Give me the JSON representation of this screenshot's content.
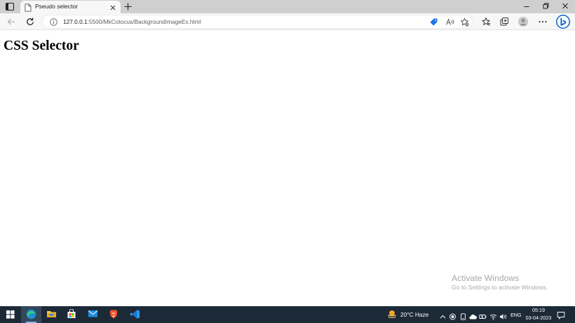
{
  "browser": {
    "tab": {
      "title": "Pseudo selector"
    },
    "address_bar": {
      "host": "127.0.0.1",
      "rest": ":5500/MkCotocus/BackgroundImageEx.html"
    }
  },
  "page": {
    "heading": "CSS Selector"
  },
  "watermark": {
    "title": "Activate Windows",
    "subtitle": "Go to Settings to activate Windows."
  },
  "taskbar": {
    "weather": "20°C  Haze",
    "language": "ENG",
    "time": "05:19",
    "date": "03-04-2023",
    "pinned_apps": [
      "start-icon",
      "edge-icon",
      "file-explorer-icon",
      "microsoft-store-icon",
      "mail-icon",
      "brave-icon",
      "vscode-icon"
    ]
  },
  "colors": {
    "accent": "#0a64c8",
    "taskbar": "#1c2a38"
  }
}
